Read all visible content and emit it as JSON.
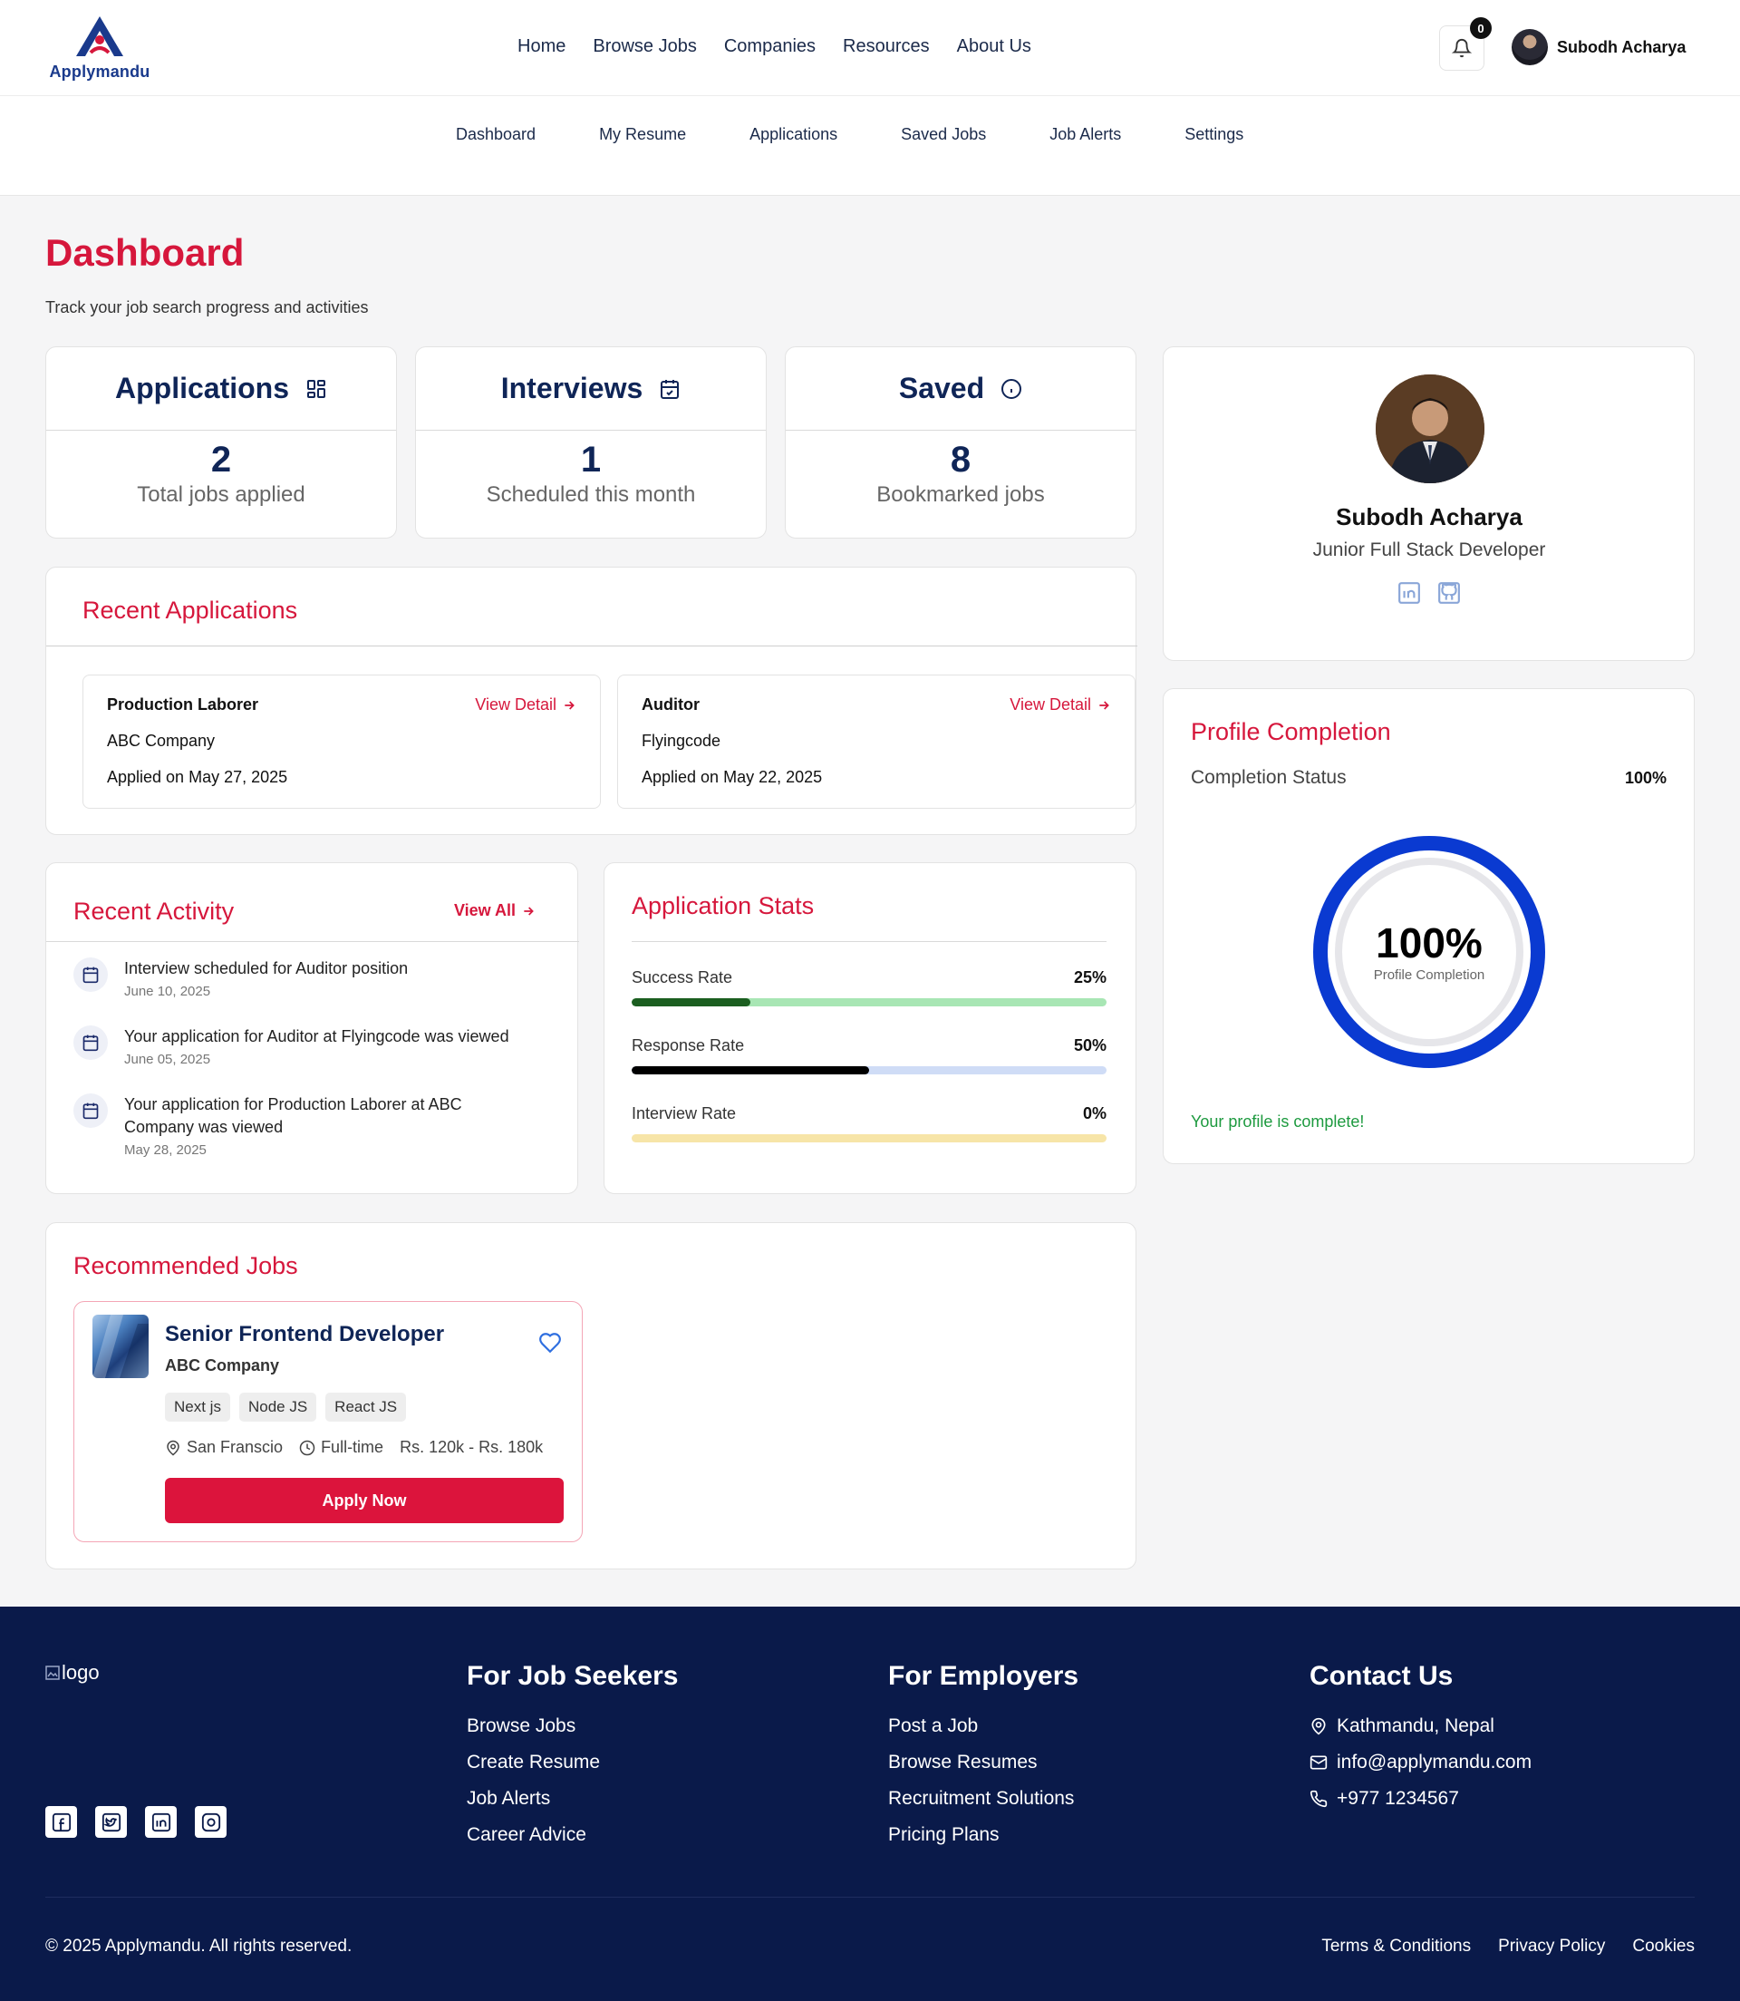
{
  "header": {
    "logo_text": "Applymandu",
    "nav": [
      "Home",
      "Browse Jobs",
      "Companies",
      "Resources",
      "About Us"
    ],
    "notification_count": "0",
    "user_name": "Subodh Acharya"
  },
  "subnav": [
    "Dashboard",
    "My Resume",
    "Applications",
    "Saved Jobs",
    "Job Alerts",
    "Settings"
  ],
  "page": {
    "title": "Dashboard",
    "subtitle": "Track your job search progress and activities"
  },
  "stats": [
    {
      "title": "Applications",
      "icon": "grid-icon",
      "value": "2",
      "caption": "Total jobs applied"
    },
    {
      "title": "Interviews",
      "icon": "calendar-check-icon",
      "value": "1",
      "caption": "Scheduled this month"
    },
    {
      "title": "Saved",
      "icon": "info-icon",
      "value": "8",
      "caption": "Bookmarked jobs"
    }
  ],
  "recent_applications": {
    "title": "Recent Applications",
    "view_label": "View Detail",
    "items": [
      {
        "position": "Production Laborer",
        "company": "ABC Company",
        "applied": "Applied on May 27, 2025"
      },
      {
        "position": "Auditor",
        "company": "Flyingcode",
        "applied": "Applied on May 22, 2025"
      }
    ]
  },
  "recent_activity": {
    "title": "Recent Activity",
    "view_all": "View All",
    "items": [
      {
        "text": "Interview scheduled for Auditor position",
        "date": "June 10, 2025"
      },
      {
        "text": "Your application for Auditor at Flyingcode was viewed",
        "date": "June 05, 2025"
      },
      {
        "text": "Your application for Production Laborer at ABC Company was viewed",
        "date": "May 28, 2025"
      }
    ]
  },
  "application_stats": {
    "title": "Application Stats",
    "rows": [
      {
        "label": "Success Rate",
        "value": "25%",
        "fraction": 0.25,
        "fill_color": "#1b5e20",
        "track_color": "#a8e6b4"
      },
      {
        "label": "Response Rate",
        "value": "50%",
        "fraction": 0.5,
        "fill_color": "#000000",
        "track_color": "#cfdcf6"
      },
      {
        "label": "Interview Rate",
        "value": "0%",
        "fraction": 0,
        "fill_color": "#d4a500",
        "track_color": "#f7e5a8"
      }
    ]
  },
  "recommended": {
    "title": "Recommended Jobs",
    "job": {
      "title": "Senior Frontend Developer",
      "company": "ABC Company",
      "tags": [
        "Next js",
        "Node JS",
        "React JS"
      ],
      "location": "San Franscio",
      "type": "Full-time",
      "salary": "Rs. 120k - Rs. 180k",
      "apply_label": "Apply Now"
    }
  },
  "profile": {
    "name": "Subodh Acharya",
    "role": "Junior Full Stack Developer",
    "social": [
      "linkedin-icon",
      "github-icon"
    ]
  },
  "completion": {
    "title": "Profile Completion",
    "label": "Completion Status",
    "value": "100%",
    "fraction": 1,
    "center_value": "100%",
    "center_label": "Profile Completion",
    "message": "Your profile is complete!",
    "ring_color": "#0a3ad1"
  },
  "footer": {
    "logo_alt": "logo",
    "job_seekers": {
      "title": "For Job Seekers",
      "links": [
        "Browse Jobs",
        "Create Resume",
        "Job Alerts",
        "Career Advice"
      ]
    },
    "employers": {
      "title": "For Employers",
      "links": [
        "Post a Job",
        "Browse Resumes",
        "Recruitment Solutions",
        "Pricing Plans"
      ]
    },
    "contact": {
      "title": "Contact Us",
      "address": "Kathmandu, Nepal",
      "email": "info@applymandu.com",
      "phone": "+977 1234567"
    },
    "copyright": "© 2025 Applymandu. All rights reserved.",
    "legal": [
      "Terms & Conditions",
      "Privacy Policy",
      "Cookies"
    ]
  },
  "colors": {
    "accent": "#d6173c",
    "navy": "#0f2557",
    "footer_bg": "#0a1a4a",
    "success": "#1d9a3f"
  }
}
